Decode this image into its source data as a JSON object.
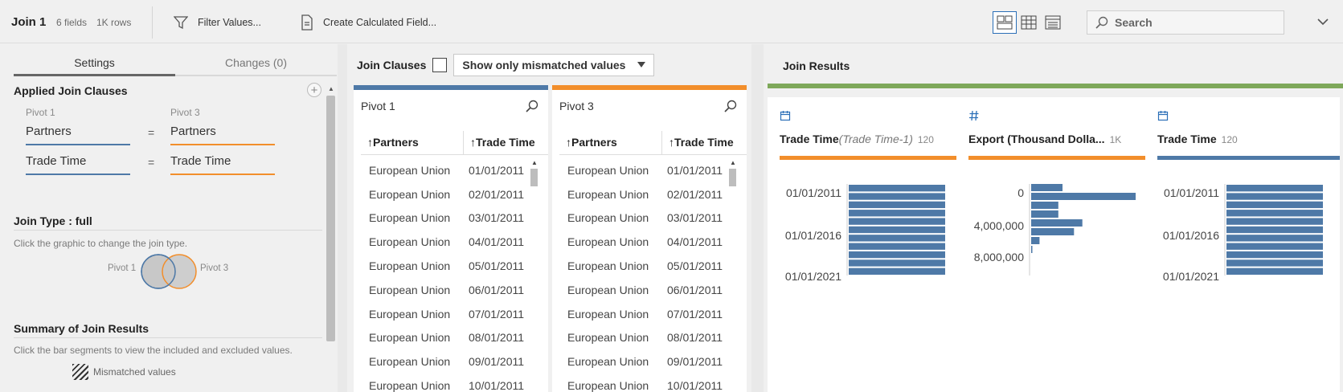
{
  "toolbar": {
    "title": "Join 1",
    "fields": "6 fields",
    "rows": "1K rows",
    "filter_label": "Filter Values...",
    "calc_label": "Create Calculated Field...",
    "search_placeholder": "Search"
  },
  "settings": {
    "tab_settings": "Settings",
    "tab_changes": "Changes (0)",
    "applied_title": "Applied Join Clauses",
    "left_source": "Pivot 1",
    "right_source": "Pivot 3",
    "clauses": [
      {
        "left": "Partners",
        "op": "=",
        "right": "Partners"
      },
      {
        "left": "Trade Time",
        "op": "=",
        "right": "Trade Time"
      }
    ],
    "join_type_title": "Join Type : full",
    "join_type_help": "Click the graphic to change the join type.",
    "venn_left": "Pivot 1",
    "venn_right": "Pivot 3",
    "summary_title": "Summary of Join Results",
    "summary_help": "Click the bar segments to view the included and excluded values.",
    "mismatched_label": "Mismatched values"
  },
  "join_clauses": {
    "title": "Join Clauses",
    "filter_option": "Show only mismatched values",
    "tables": [
      {
        "name": "Pivot 1",
        "color": "#4e79a7",
        "col1": "Partners",
        "col2": "Trade Time",
        "rows": [
          [
            "European Union",
            "01/01/2011"
          ],
          [
            "European Union",
            "02/01/2011"
          ],
          [
            "European Union",
            "03/01/2011"
          ],
          [
            "European Union",
            "04/01/2011"
          ],
          [
            "European Union",
            "05/01/2011"
          ],
          [
            "European Union",
            "06/01/2011"
          ],
          [
            "European Union",
            "07/01/2011"
          ],
          [
            "European Union",
            "08/01/2011"
          ],
          [
            "European Union",
            "09/01/2011"
          ],
          [
            "European Union",
            "10/01/2011"
          ]
        ]
      },
      {
        "name": "Pivot 3",
        "color": "#f28e2b",
        "col1": "Partners",
        "col2": "Trade Time",
        "rows": [
          [
            "European Union",
            "01/01/2011"
          ],
          [
            "European Union",
            "02/01/2011"
          ],
          [
            "European Union",
            "03/01/2011"
          ],
          [
            "European Union",
            "04/01/2011"
          ],
          [
            "European Union",
            "05/01/2011"
          ],
          [
            "European Union",
            "06/01/2011"
          ],
          [
            "European Union",
            "07/01/2011"
          ],
          [
            "European Union",
            "08/01/2011"
          ],
          [
            "European Union",
            "09/01/2011"
          ],
          [
            "European Union",
            "10/01/2011"
          ]
        ]
      }
    ]
  },
  "join_results": {
    "title": "Join Results",
    "accent": "#7ea85a",
    "cards": [
      {
        "type_icon": "calendar-icon",
        "name": "Trade Time",
        "alias": "(Trade Time-1)",
        "count": "120",
        "color": "#f28e2b",
        "tick_labels": [
          "01/01/2011",
          "01/01/2016",
          "01/01/2021"
        ],
        "bins": [
          1,
          1,
          1,
          1,
          1,
          1,
          1,
          1,
          1,
          1,
          1
        ]
      },
      {
        "type_icon": "hash-icon",
        "name": "Export (Thousand Dolla...",
        "alias": "",
        "count": "1K",
        "color": "#f28e2b",
        "tick_labels": [
          "0",
          "4,000,000",
          "8,000,000"
        ],
        "bins": [
          0.3,
          1.0,
          0.26,
          0.26,
          0.49,
          0.41,
          0.08,
          0.01
        ]
      },
      {
        "type_icon": "calendar-icon",
        "name": "Trade Time",
        "alias": "",
        "count": "120",
        "color": "#4e79a7",
        "tick_labels": [
          "01/01/2011",
          "01/01/2016",
          "01/01/2021"
        ],
        "bins": [
          1,
          1,
          1,
          1,
          1,
          1,
          1,
          1,
          1,
          1,
          1
        ]
      }
    ]
  }
}
